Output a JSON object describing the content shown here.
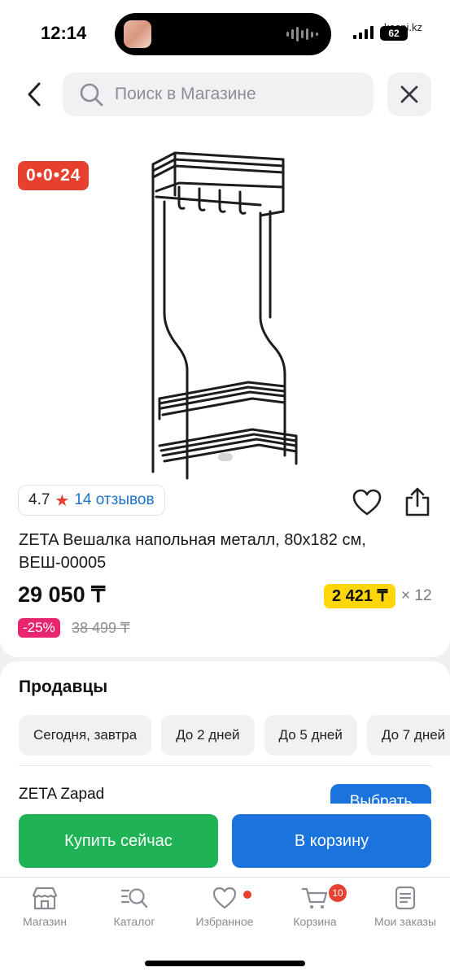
{
  "status_bar": {
    "time": "12:14",
    "battery": "62",
    "site": "kaspi.kz"
  },
  "search": {
    "placeholder": "Поиск в Магазине"
  },
  "product": {
    "timer": "0•0•24",
    "rating": "4.7",
    "reviews": "14 отзывов",
    "title": "ZETA Вешалка напольная металл, 80x182 см, ВЕШ-00005",
    "price": "29 050 ₸",
    "installment": "2 421 ₸",
    "installment_months": "× 12",
    "discount": "-25%",
    "old_price": "38 499 ₸"
  },
  "sellers": {
    "title": "Продавцы",
    "chips": [
      "Сегодня, завтра",
      "До 2 дней",
      "До 5 дней",
      "До 7 дней"
    ],
    "seller_name": "ZETA Zapad",
    "choose_label": "Выбрать"
  },
  "actions": {
    "buy_now": "Купить сейчас",
    "add_to_cart": "В корзину"
  },
  "tabbar": {
    "items": [
      {
        "label": "Магазин",
        "icon": "store-icon"
      },
      {
        "label": "Каталог",
        "icon": "catalog-search-icon"
      },
      {
        "label": "Избранное",
        "icon": "heart-icon"
      },
      {
        "label": "Корзина",
        "icon": "cart-icon"
      },
      {
        "label": "Мои заказы",
        "icon": "orders-icon"
      }
    ],
    "cart_count": "10"
  },
  "colors": {
    "accent_blue": "#1b73dd",
    "buy_green": "#1fb356",
    "timer_red": "#e8402f",
    "discount_pink": "#e8266f",
    "installment_yellow": "#ffd60a"
  }
}
